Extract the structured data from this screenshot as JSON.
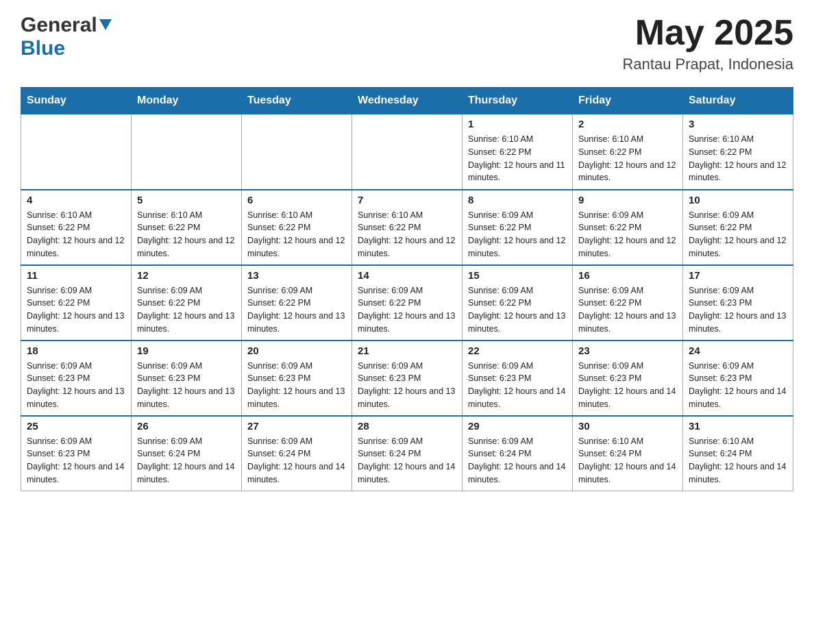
{
  "header": {
    "logo_general": "General",
    "logo_blue": "Blue",
    "month_title": "May 2025",
    "location": "Rantau Prapat, Indonesia"
  },
  "days_of_week": [
    "Sunday",
    "Monday",
    "Tuesday",
    "Wednesday",
    "Thursday",
    "Friday",
    "Saturday"
  ],
  "weeks": [
    [
      {
        "day": "",
        "sunrise": "",
        "sunset": "",
        "daylight": ""
      },
      {
        "day": "",
        "sunrise": "",
        "sunset": "",
        "daylight": ""
      },
      {
        "day": "",
        "sunrise": "",
        "sunset": "",
        "daylight": ""
      },
      {
        "day": "",
        "sunrise": "",
        "sunset": "",
        "daylight": ""
      },
      {
        "day": "1",
        "sunrise": "Sunrise: 6:10 AM",
        "sunset": "Sunset: 6:22 PM",
        "daylight": "Daylight: 12 hours and 11 minutes."
      },
      {
        "day": "2",
        "sunrise": "Sunrise: 6:10 AM",
        "sunset": "Sunset: 6:22 PM",
        "daylight": "Daylight: 12 hours and 12 minutes."
      },
      {
        "day": "3",
        "sunrise": "Sunrise: 6:10 AM",
        "sunset": "Sunset: 6:22 PM",
        "daylight": "Daylight: 12 hours and 12 minutes."
      }
    ],
    [
      {
        "day": "4",
        "sunrise": "Sunrise: 6:10 AM",
        "sunset": "Sunset: 6:22 PM",
        "daylight": "Daylight: 12 hours and 12 minutes."
      },
      {
        "day": "5",
        "sunrise": "Sunrise: 6:10 AM",
        "sunset": "Sunset: 6:22 PM",
        "daylight": "Daylight: 12 hours and 12 minutes."
      },
      {
        "day": "6",
        "sunrise": "Sunrise: 6:10 AM",
        "sunset": "Sunset: 6:22 PM",
        "daylight": "Daylight: 12 hours and 12 minutes."
      },
      {
        "day": "7",
        "sunrise": "Sunrise: 6:10 AM",
        "sunset": "Sunset: 6:22 PM",
        "daylight": "Daylight: 12 hours and 12 minutes."
      },
      {
        "day": "8",
        "sunrise": "Sunrise: 6:09 AM",
        "sunset": "Sunset: 6:22 PM",
        "daylight": "Daylight: 12 hours and 12 minutes."
      },
      {
        "day": "9",
        "sunrise": "Sunrise: 6:09 AM",
        "sunset": "Sunset: 6:22 PM",
        "daylight": "Daylight: 12 hours and 12 minutes."
      },
      {
        "day": "10",
        "sunrise": "Sunrise: 6:09 AM",
        "sunset": "Sunset: 6:22 PM",
        "daylight": "Daylight: 12 hours and 12 minutes."
      }
    ],
    [
      {
        "day": "11",
        "sunrise": "Sunrise: 6:09 AM",
        "sunset": "Sunset: 6:22 PM",
        "daylight": "Daylight: 12 hours and 13 minutes."
      },
      {
        "day": "12",
        "sunrise": "Sunrise: 6:09 AM",
        "sunset": "Sunset: 6:22 PM",
        "daylight": "Daylight: 12 hours and 13 minutes."
      },
      {
        "day": "13",
        "sunrise": "Sunrise: 6:09 AM",
        "sunset": "Sunset: 6:22 PM",
        "daylight": "Daylight: 12 hours and 13 minutes."
      },
      {
        "day": "14",
        "sunrise": "Sunrise: 6:09 AM",
        "sunset": "Sunset: 6:22 PM",
        "daylight": "Daylight: 12 hours and 13 minutes."
      },
      {
        "day": "15",
        "sunrise": "Sunrise: 6:09 AM",
        "sunset": "Sunset: 6:22 PM",
        "daylight": "Daylight: 12 hours and 13 minutes."
      },
      {
        "day": "16",
        "sunrise": "Sunrise: 6:09 AM",
        "sunset": "Sunset: 6:22 PM",
        "daylight": "Daylight: 12 hours and 13 minutes."
      },
      {
        "day": "17",
        "sunrise": "Sunrise: 6:09 AM",
        "sunset": "Sunset: 6:23 PM",
        "daylight": "Daylight: 12 hours and 13 minutes."
      }
    ],
    [
      {
        "day": "18",
        "sunrise": "Sunrise: 6:09 AM",
        "sunset": "Sunset: 6:23 PM",
        "daylight": "Daylight: 12 hours and 13 minutes."
      },
      {
        "day": "19",
        "sunrise": "Sunrise: 6:09 AM",
        "sunset": "Sunset: 6:23 PM",
        "daylight": "Daylight: 12 hours and 13 minutes."
      },
      {
        "day": "20",
        "sunrise": "Sunrise: 6:09 AM",
        "sunset": "Sunset: 6:23 PM",
        "daylight": "Daylight: 12 hours and 13 minutes."
      },
      {
        "day": "21",
        "sunrise": "Sunrise: 6:09 AM",
        "sunset": "Sunset: 6:23 PM",
        "daylight": "Daylight: 12 hours and 13 minutes."
      },
      {
        "day": "22",
        "sunrise": "Sunrise: 6:09 AM",
        "sunset": "Sunset: 6:23 PM",
        "daylight": "Daylight: 12 hours and 14 minutes."
      },
      {
        "day": "23",
        "sunrise": "Sunrise: 6:09 AM",
        "sunset": "Sunset: 6:23 PM",
        "daylight": "Daylight: 12 hours and 14 minutes."
      },
      {
        "day": "24",
        "sunrise": "Sunrise: 6:09 AM",
        "sunset": "Sunset: 6:23 PM",
        "daylight": "Daylight: 12 hours and 14 minutes."
      }
    ],
    [
      {
        "day": "25",
        "sunrise": "Sunrise: 6:09 AM",
        "sunset": "Sunset: 6:23 PM",
        "daylight": "Daylight: 12 hours and 14 minutes."
      },
      {
        "day": "26",
        "sunrise": "Sunrise: 6:09 AM",
        "sunset": "Sunset: 6:24 PM",
        "daylight": "Daylight: 12 hours and 14 minutes."
      },
      {
        "day": "27",
        "sunrise": "Sunrise: 6:09 AM",
        "sunset": "Sunset: 6:24 PM",
        "daylight": "Daylight: 12 hours and 14 minutes."
      },
      {
        "day": "28",
        "sunrise": "Sunrise: 6:09 AM",
        "sunset": "Sunset: 6:24 PM",
        "daylight": "Daylight: 12 hours and 14 minutes."
      },
      {
        "day": "29",
        "sunrise": "Sunrise: 6:09 AM",
        "sunset": "Sunset: 6:24 PM",
        "daylight": "Daylight: 12 hours and 14 minutes."
      },
      {
        "day": "30",
        "sunrise": "Sunrise: 6:10 AM",
        "sunset": "Sunset: 6:24 PM",
        "daylight": "Daylight: 12 hours and 14 minutes."
      },
      {
        "day": "31",
        "sunrise": "Sunrise: 6:10 AM",
        "sunset": "Sunset: 6:24 PM",
        "daylight": "Daylight: 12 hours and 14 minutes."
      }
    ]
  ]
}
